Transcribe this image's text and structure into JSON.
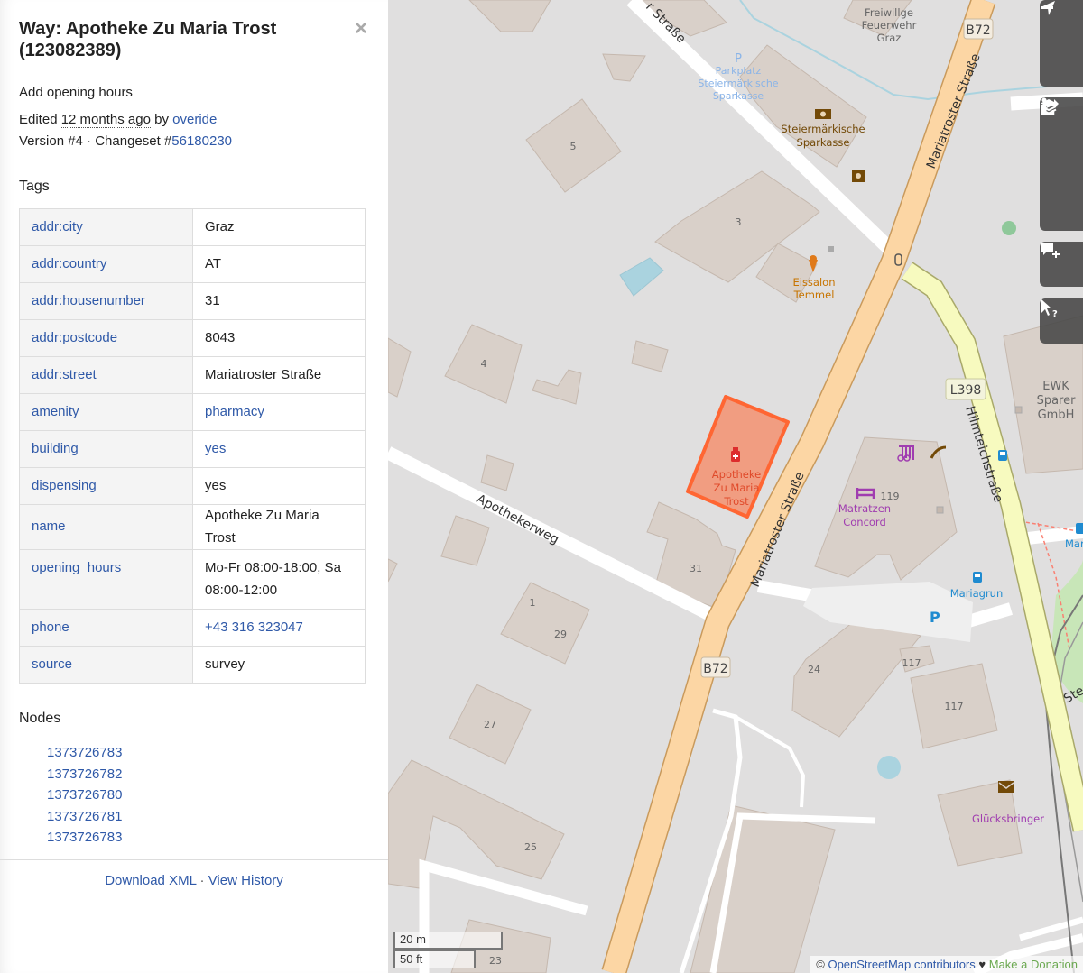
{
  "sidebar": {
    "title": "Way: Apotheke Zu Maria Trost (123082389)",
    "close_label": "×",
    "comment": "Add opening hours",
    "edited_prefix": "Edited ",
    "edited_time": "12 months ago",
    "edited_by": " by ",
    "user": "overide",
    "version_text": "Version #4 · Changeset #",
    "changeset": "56180230",
    "tags_heading": "Tags",
    "tags": [
      {
        "key": "addr:city",
        "value": "Graz",
        "value_link": false
      },
      {
        "key": "addr:country",
        "value": "AT",
        "value_link": false
      },
      {
        "key": "addr:housenumber",
        "value": "31",
        "value_link": false
      },
      {
        "key": "addr:postcode",
        "value": "8043",
        "value_link": false
      },
      {
        "key": "addr:street",
        "value": "Mariatroster Straße",
        "value_link": false
      },
      {
        "key": "amenity",
        "value": "pharmacy",
        "value_link": true
      },
      {
        "key": "building",
        "value": "yes",
        "value_link": true
      },
      {
        "key": "dispensing",
        "value": "yes",
        "value_link": false
      },
      {
        "key": "name",
        "value": "Apotheke Zu Maria Trost",
        "value_link": false
      },
      {
        "key": "opening_hours",
        "value": "Mo-Fr 08:00-18:00, Sa 08:00-12:00",
        "value_link": false
      },
      {
        "key": "phone",
        "value": "+43 316 323047",
        "value_link": true
      },
      {
        "key": "source",
        "value": "survey",
        "value_link": false
      }
    ],
    "nodes_heading": "Nodes",
    "nodes": [
      "1373726783",
      "1373726782",
      "1373726780",
      "1373726781",
      "1373726783"
    ],
    "footer": {
      "download": "Download XML",
      "separator": " · ",
      "history": "View History"
    }
  },
  "map": {
    "controls": [
      {
        "name": "zoom-out",
        "icon": "minus-icon"
      },
      {
        "name": "locate",
        "icon": "location-arrow-icon"
      },
      {
        "name": "layers",
        "icon": "layers-icon"
      },
      {
        "name": "map-key",
        "icon": "info-icon"
      },
      {
        "name": "share",
        "icon": "share-icon"
      },
      {
        "name": "add-note",
        "icon": "add-note-icon"
      },
      {
        "name": "query-features",
        "icon": "query-cursor-icon"
      }
    ],
    "labels": {
      "street_top": "r Straße",
      "parking_name": "Parkplatz Steiermärkische Sparkasse",
      "fire_station": "Freiwillge Feuerwehr Graz",
      "bank": "Steiermärkische Sparkasse",
      "ice_cream": "Eissalon Temmel",
      "pharmacy": "Apotheke Zu Maria Trost",
      "mariatroster_1": "Mariatroster Straße",
      "mariatroster_2": "Mariatroster Straße",
      "apothekerweg": "Apothekerweg",
      "hilmteich": "Hilmteichstraße",
      "matratzen": "Matratzen Concord",
      "ewk": "EWK Sparer GmbH",
      "mariagrun": "Mariagrun",
      "maria_cut": "Maria",
      "gluecksbringer": "Glücksbringer",
      "ste": "Ste",
      "route_b72_a": "B72",
      "route_b72_b": "B72",
      "route_l398": "L398",
      "hn_5": "5",
      "hn_3": "3",
      "hn_4": "4",
      "hn_31": "31",
      "hn_1": "1",
      "hn_29": "29",
      "hn_27": "27",
      "hn_25": "25",
      "hn_23": "23",
      "hn_24": "24",
      "hn_117a": "117",
      "hn_117b": "117",
      "hn_119": "119",
      "parking_p": "P"
    },
    "scale": {
      "metric": "20 m",
      "imperial": "50 ft"
    },
    "attribution": {
      "copyright": "© ",
      "osm": "OpenStreetMap contributors",
      "heart": " ♥ ",
      "donate": "Make a Donation"
    },
    "colors": {
      "background": "#e0dfdf",
      "building": "#d9d0c9",
      "building_stroke": "#c5b8ae",
      "primary_road": "#fcd6a4",
      "primary_casing": "#c99a5c",
      "secondary_road": "#f7fabf",
      "secondary_casing": "#a9a96a",
      "highlight": "#ff6633",
      "link": "#2f59a8"
    }
  }
}
